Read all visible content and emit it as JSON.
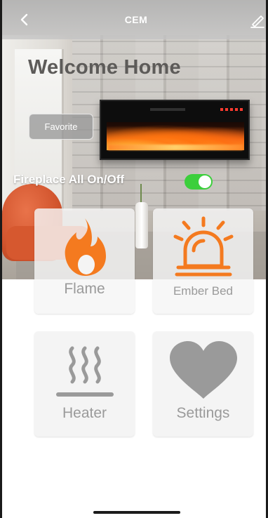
{
  "header": {
    "title": "CEM",
    "back_icon": "chevron-left-icon",
    "edit_icon": "pencil-icon"
  },
  "hero": {
    "welcome_text": "Welcome Home",
    "favorite_label": "Favorite"
  },
  "master_switch": {
    "label": "Fireplace All On/Off",
    "state": "on",
    "on_color": "#3CCF3C"
  },
  "tiles": [
    {
      "label": "Flame",
      "icon": "flame-icon",
      "color": "#F47A1F"
    },
    {
      "label": "Ember Bed",
      "icon": "beacon-icon",
      "color": "#F47A1F"
    },
    {
      "label": "Heater",
      "icon": "heat-waves-icon",
      "color": "#9A9A9A"
    },
    {
      "label": "Settings",
      "icon": "heart-icon",
      "color": "#9A9A9A"
    }
  ]
}
